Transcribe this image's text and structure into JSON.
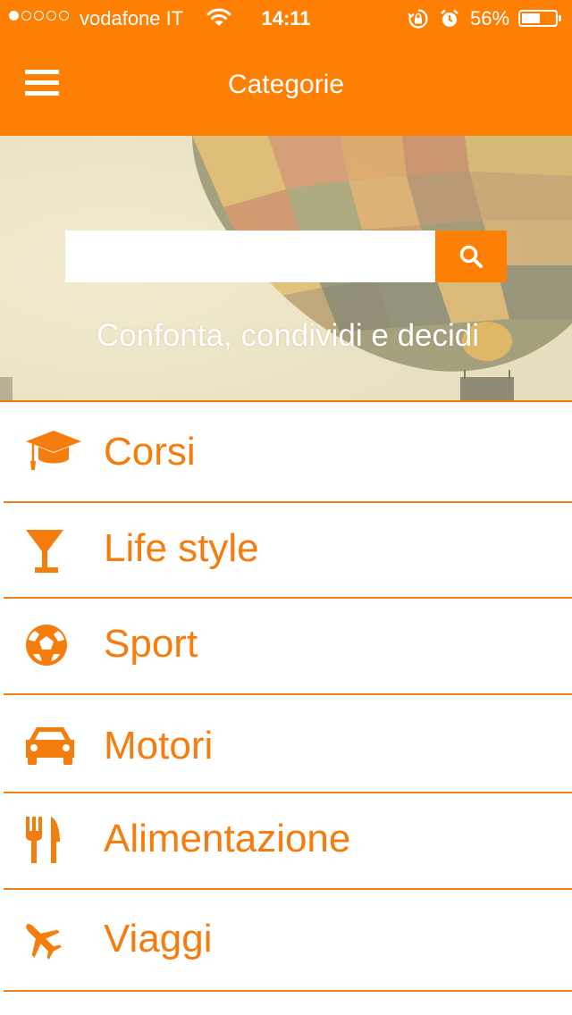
{
  "colors": {
    "brand": "#fd7f03",
    "label": "#f57d0d",
    "divider": "#ec7e18"
  },
  "status_bar": {
    "carrier": "vodafone IT",
    "time": "14:11",
    "battery_percent": "56%",
    "battery_level": 0.56,
    "signal_bars_filled": 1,
    "signal_bars_total": 5,
    "icons": [
      "wifi-icon",
      "rotation-lock-icon",
      "alarm-icon",
      "battery-icon"
    ]
  },
  "nav_bar": {
    "title": "Categorie",
    "menu_icon": "hamburger-menu-icon"
  },
  "hero": {
    "search": {
      "value": "",
      "placeholder": "",
      "button_icon": "search-icon"
    },
    "tagline": "Confonta, condividi e decidi"
  },
  "categories": [
    {
      "label": "Corsi",
      "icon": "graduation-cap-icon"
    },
    {
      "label": "Life style",
      "icon": "cocktail-glass-icon"
    },
    {
      "label": "Sport",
      "icon": "soccer-ball-icon"
    },
    {
      "label": "Motori",
      "icon": "car-icon"
    },
    {
      "label": "Alimentazione",
      "icon": "fork-knife-icon"
    },
    {
      "label": "Viaggi",
      "icon": "airplane-icon"
    }
  ]
}
